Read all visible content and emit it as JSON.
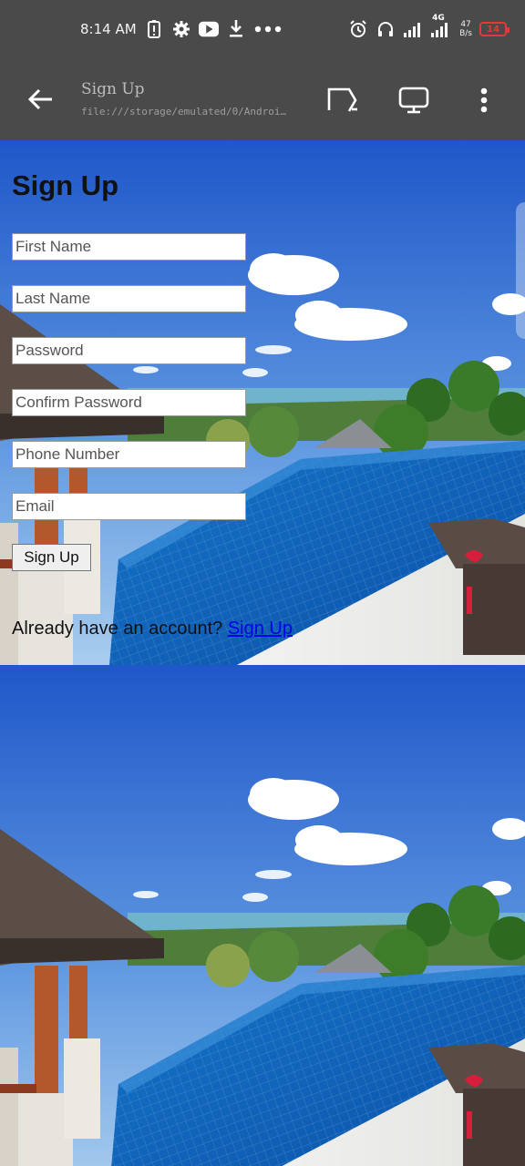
{
  "status_bar": {
    "time": "8:14 AM",
    "network_type": "4G",
    "net_speed_value": "47",
    "net_speed_unit": "B/s",
    "battery_level": "14",
    "icons_left": [
      "battery-saver-icon",
      "settings-icon",
      "youtube-icon",
      "download-icon",
      "more-dots-icon"
    ],
    "icons_right": [
      "alarm-icon",
      "headphones-icon",
      "signal-icon",
      "signal-4g-icon",
      "battery-icon"
    ]
  },
  "toolbar": {
    "title": "Sign Up",
    "url": "file:///storage/emulated/0/Android/data/c...",
    "icons": [
      "back-arrow-icon",
      "cast-icon",
      "desktop-icon",
      "more-vert-icon"
    ]
  },
  "form": {
    "heading": "Sign Up",
    "fields": {
      "first_name": "First Name",
      "last_name": "Last Name",
      "password": "Password",
      "confirm_password": "Confirm Password",
      "phone_number": "Phone Number",
      "email": "Email"
    },
    "submit_label": "Sign Up",
    "footer_text": "Already have an account?",
    "footer_link": "Sign Up"
  },
  "colors": {
    "bar_bg": "#4a4a4a",
    "link": "#0000ee",
    "battery_low": "#e53935"
  }
}
